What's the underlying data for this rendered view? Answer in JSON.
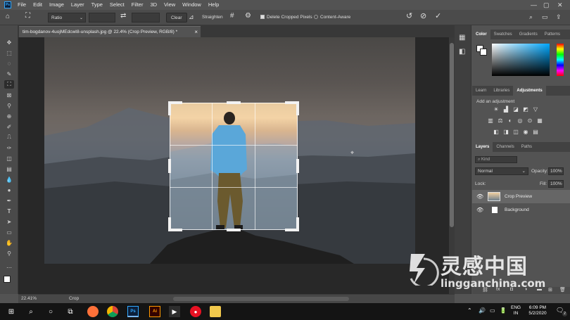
{
  "menubar": {
    "logo": "Ps",
    "items": [
      "File",
      "Edit",
      "Image",
      "Layer",
      "Type",
      "Select",
      "Filter",
      "3D",
      "View",
      "Window",
      "Help"
    ],
    "window_controls": [
      "—",
      "▢",
      "✕"
    ]
  },
  "options": {
    "ratio_value": "Ratio",
    "clear_label": "Clear",
    "straighten_label": "Straighten",
    "delete_cropped_label": "Delete Cropped Pixels",
    "content_aware_label": "Content-Aware"
  },
  "document": {
    "tab_title": "tim-bogdanov-4uojMEdcwI8-unsplash.jpg @ 22.4% (Crop Preview, RGB/8) *",
    "tab_close": "×",
    "zoom": "22.41%",
    "status": "Crop"
  },
  "panels": {
    "color_tabs": [
      "Color",
      "Swatches",
      "Gradients",
      "Patterns"
    ],
    "adjust_tabs": [
      "Learn",
      "Libraries",
      "Adjustments"
    ],
    "add_adjustment_label": "Add an adjustment",
    "layer_tabs": [
      "Layers",
      "Channels",
      "Paths"
    ],
    "kind_placeholder": "Kind",
    "blend_mode": "Normal",
    "opacity_label": "Opacity:",
    "opacity_value": "100%",
    "lock_label": "Lock:",
    "fill_label": "Fill:",
    "fill_value": "100%",
    "layers": [
      {
        "name": "Crop Preview"
      },
      {
        "name": "Background"
      }
    ]
  },
  "taskbar": {
    "lang_line1": "ENG",
    "lang_line2": "IN",
    "time": "6:09 PM",
    "date": "5/2/2020",
    "notification_count": "2"
  },
  "watermark": {
    "cn_text": "灵感中国",
    "url_text": "lingganchina.com"
  },
  "colors": {
    "accent": "#31a8ff",
    "panel_bg": "#535353",
    "sky_orange": "#f3d3a6",
    "jacket_blue": "#5aa7d9"
  }
}
